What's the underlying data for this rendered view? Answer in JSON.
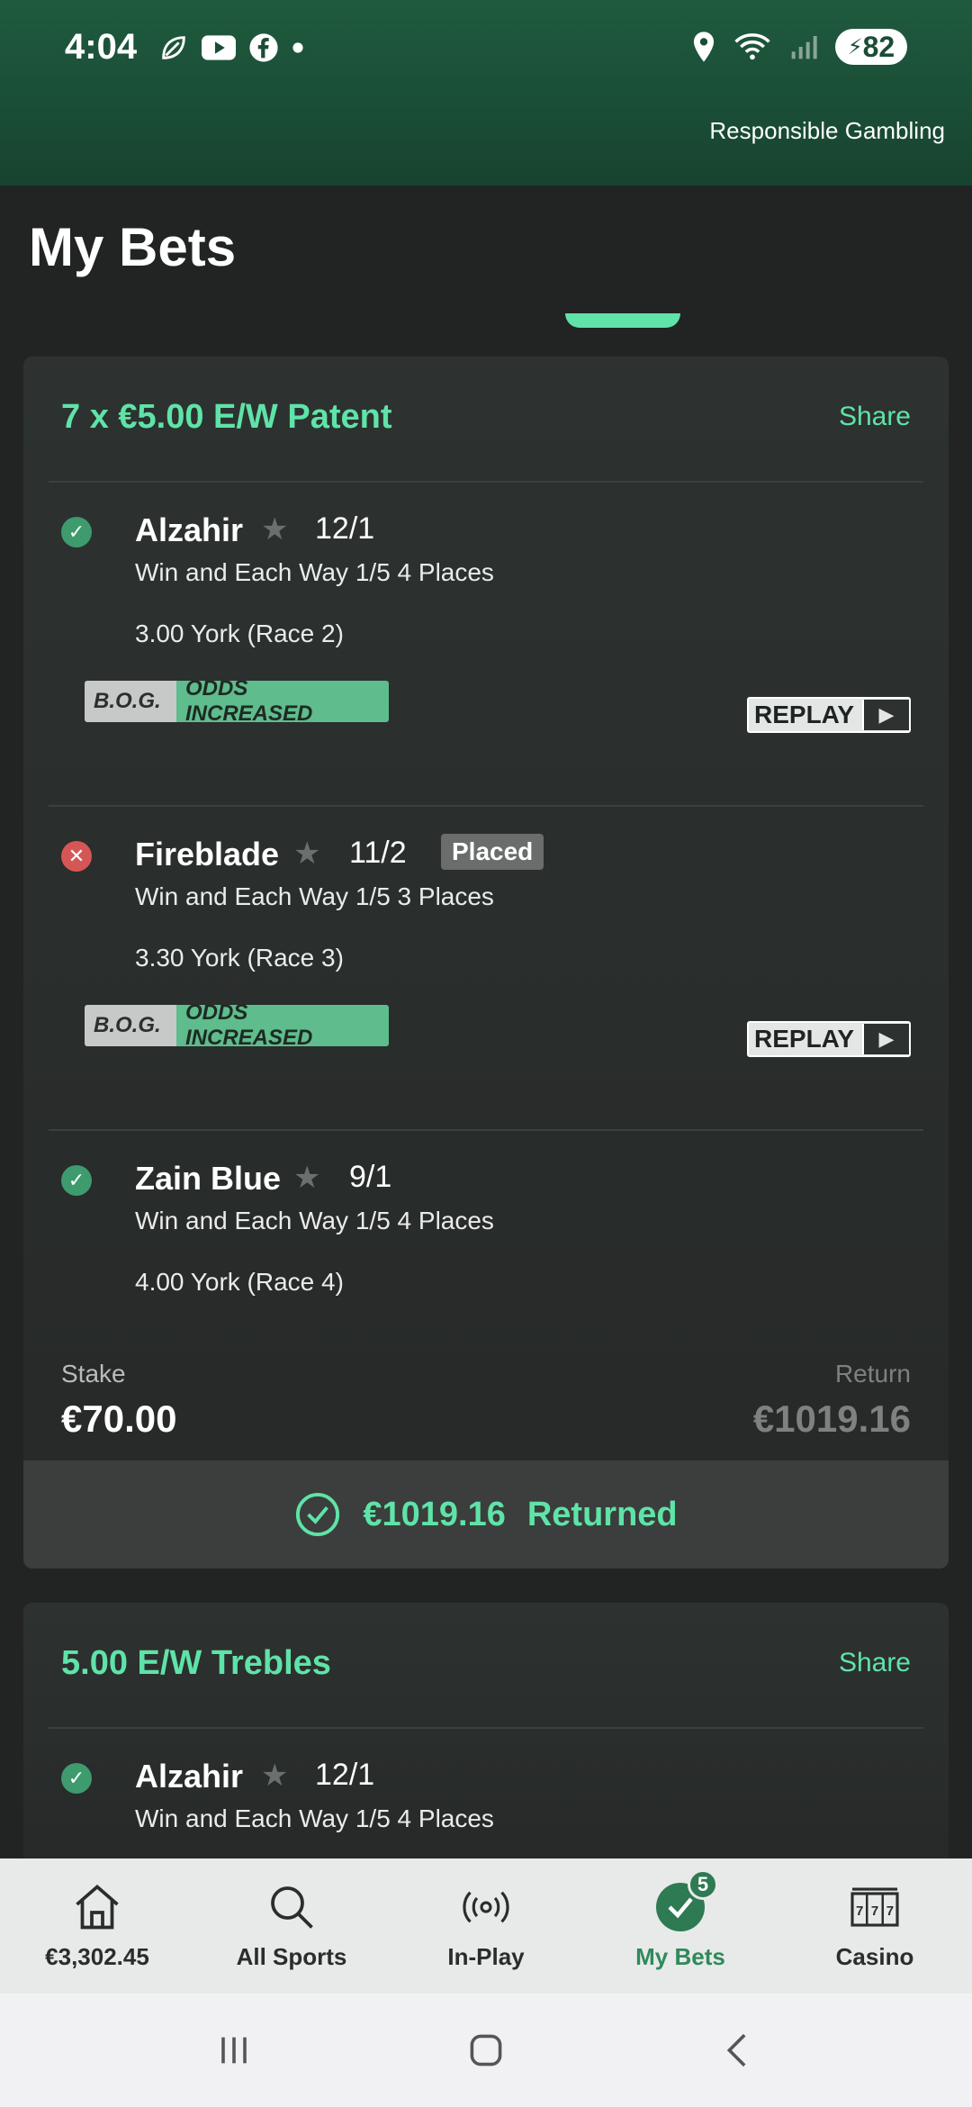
{
  "status_bar": {
    "time": "4:04",
    "battery": "82"
  },
  "header": {
    "responsible_gambling": "Responsible Gambling",
    "title": "My Bets"
  },
  "bets": [
    {
      "title": "7 x €5.00 E/W Patent",
      "share_label": "Share",
      "selections": [
        {
          "name": "Alzahir",
          "odds": "12/1",
          "status": "win",
          "placed": "",
          "market": "Win and Each Way 1/5 4 Places",
          "race": "3.00 York (Race 2)",
          "bog": true
        },
        {
          "name": "Fireblade",
          "odds": "11/2",
          "status": "lose",
          "placed": "Placed",
          "market": "Win and Each Way 1/5 3 Places",
          "race": "3.30 York (Race 3)",
          "bog": true
        },
        {
          "name": "Zain Blue",
          "odds": "9/1",
          "status": "win",
          "placed": "",
          "market": "Win and Each Way 1/5 4 Places",
          "race": "4.00 York (Race 4)",
          "bog": false
        }
      ],
      "stake_label": "Stake",
      "stake": "€70.00",
      "return_label": "Return",
      "return": "€1019.16",
      "returned_amount": "€1019.16",
      "returned_label": "Returned"
    },
    {
      "title": "5.00 E/W Trebles",
      "share_label": "Share",
      "selections": [
        {
          "name": "Alzahir",
          "odds": "12/1",
          "status": "win",
          "market": "Win and Each Way 1/5 4 Places"
        }
      ]
    }
  ],
  "bog": {
    "left": "B.O.G.",
    "right": "ODDS INCREASED"
  },
  "replay_label": "REPLAY",
  "bottom_nav": [
    {
      "label": "€3,302.45",
      "icon": "home-icon"
    },
    {
      "label": "All Sports",
      "icon": "search-icon"
    },
    {
      "label": "In-Play",
      "icon": "broadcast-icon"
    },
    {
      "label": "My Bets",
      "icon": "check-circle-icon",
      "badge": "5"
    },
    {
      "label": "Casino",
      "icon": "slot-machine-icon"
    }
  ],
  "colors": {
    "accent": "#5fe3a8",
    "header": "#1f5a3e",
    "win": "#3e9b6e",
    "lose": "#d65656"
  }
}
